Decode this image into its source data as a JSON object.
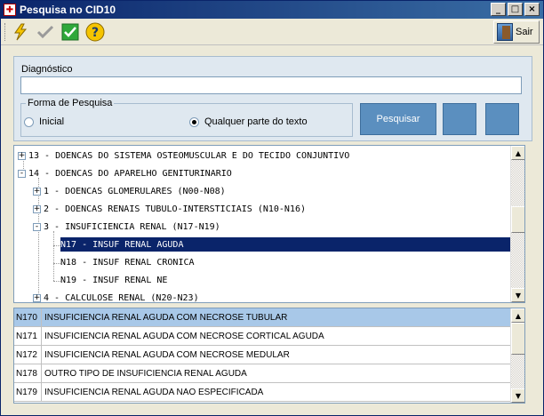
{
  "window": {
    "title": "Pesquisa no CID10"
  },
  "toolbar": {
    "sair_label": "Sair"
  },
  "form": {
    "diagnostico_label": "Diagnóstico",
    "diagnostico_value": "",
    "forma_label": "Forma de Pesquisa",
    "radio_inicial": "Inicial",
    "radio_qualquer": "Qualquer parte do texto",
    "selected_option": "Qualquer parte do texto",
    "pesquisar_label": "Pesquisar"
  },
  "tree": {
    "rows": [
      {
        "text": "13 - DOENCAS DO SISTEMA OSTEOMUSCULAR E DO TECIDO CONJUNTIVO",
        "expander": "+"
      },
      {
        "text": "14 - DOENCAS DO APARELHO GENITURINARIO",
        "expander": "-"
      },
      {
        "text": "1 - DOENCAS GLOMERULARES (N00-N08)",
        "expander": "+"
      },
      {
        "text": "2 - DOENCAS RENAIS TUBULO-INTERSTICIAIS (N10-N16)",
        "expander": "+"
      },
      {
        "text": "3 - INSUFICIENCIA  RENAL (N17-N19)",
        "expander": "-"
      },
      {
        "text": "N17 - INSUF RENAL AGUDA",
        "expander": ""
      },
      {
        "text": "N18 - INSUF RENAL CRONICA",
        "expander": ""
      },
      {
        "text": "N19 - INSUF RENAL NE",
        "expander": ""
      },
      {
        "text": "4 - CALCULOSE RENAL (N20-N23)",
        "expander": "+"
      }
    ]
  },
  "grid": {
    "rows": [
      {
        "code": "N170",
        "desc": "INSUFICIENCIA RENAL AGUDA COM NECROSE TUBULAR"
      },
      {
        "code": "N171",
        "desc": "INSUFICIENCIA RENAL AGUDA COM NECROSE CORTICAL AGUDA"
      },
      {
        "code": "N172",
        "desc": "INSUFICIENCIA RENAL AGUDA COM NECROSE MEDULAR"
      },
      {
        "code": "N178",
        "desc": "OUTRO TIPO DE INSUFICIENCIA RENAL AGUDA"
      },
      {
        "code": "N179",
        "desc": "INSUFICIENCIA RENAL AGUDA NAO ESPECIFICADA"
      }
    ]
  },
  "icons": {
    "app": "cid-app-icon",
    "lightning": "lightning-icon",
    "check_gray": "check-gray-icon",
    "check_green": "check-green-icon",
    "help": "help-icon",
    "door": "door-exit-icon"
  }
}
